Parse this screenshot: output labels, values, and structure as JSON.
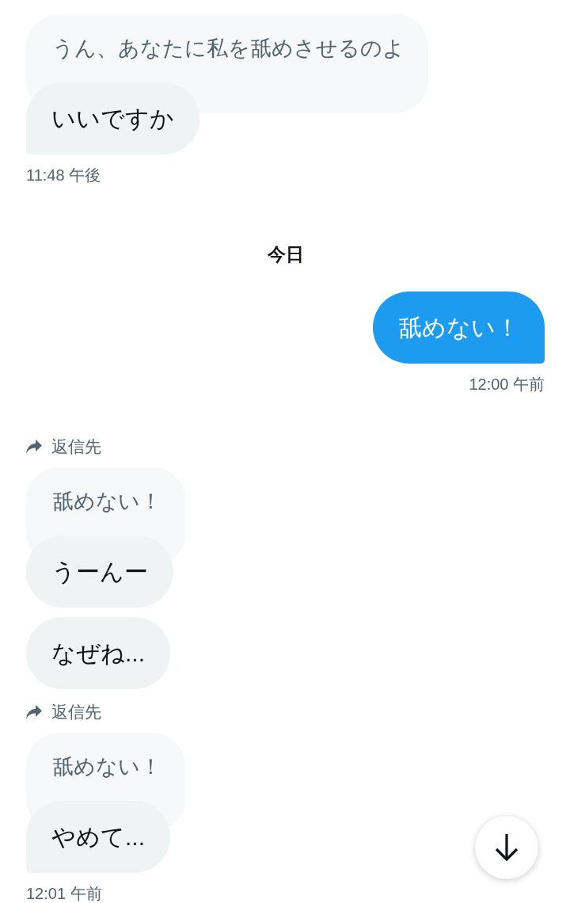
{
  "messages": [
    {
      "kind": "received",
      "quote": "うん、あなたに私を舐めさせるのよ",
      "text": "いいですか",
      "time": "11:48 午後"
    },
    {
      "kind": "date",
      "text": "今日"
    },
    {
      "kind": "sent",
      "text": "舐めない！",
      "time": "12:00 午前"
    },
    {
      "kind": "received",
      "reply_label": "返信先",
      "quote": "舐めない！",
      "text": "うーんー"
    },
    {
      "kind": "received",
      "text": "なぜね..."
    },
    {
      "kind": "received",
      "reply_label": "返信先",
      "quote": "舐めない！",
      "text": "やめて...",
      "time": "12:01 午前"
    }
  ]
}
